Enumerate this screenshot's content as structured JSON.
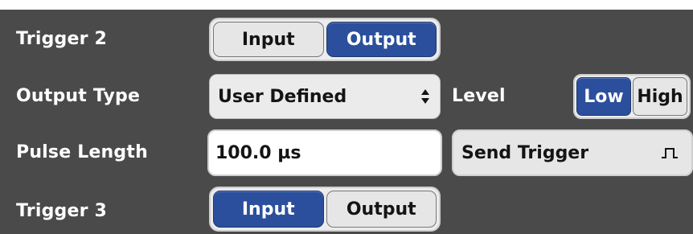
{
  "trigger2": {
    "label": "Trigger 2",
    "options": [
      "Input",
      "Output"
    ],
    "selected": "Output"
  },
  "output_type": {
    "label": "Output Type",
    "value": "User Defined",
    "arrow_icon": "updown-arrows-icon"
  },
  "level": {
    "label": "Level",
    "options": [
      "Low",
      "High"
    ],
    "selected": "Low"
  },
  "pulse_length": {
    "label": "Pulse Length",
    "value": "100.0 µs"
  },
  "send_trigger": {
    "label": "Send Trigger",
    "icon": "pulse-icon"
  },
  "trigger3": {
    "label": "Trigger 3",
    "options": [
      "Input",
      "Output"
    ],
    "selected": "Input"
  },
  "colors": {
    "panel": "#4a4a4a",
    "active_segment": "#2b4f9c",
    "label_text": "#ffffff"
  }
}
